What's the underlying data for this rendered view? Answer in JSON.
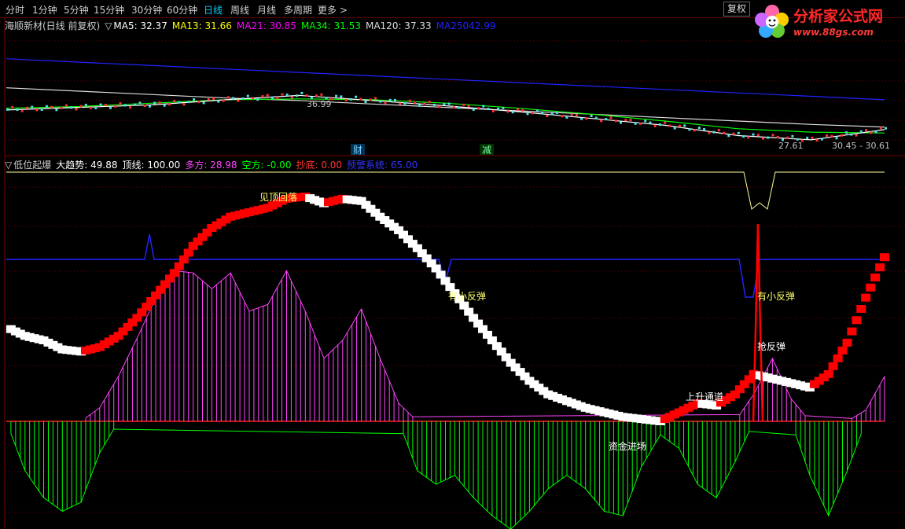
{
  "toolbar": {
    "tabs": [
      "分时",
      "1分钟",
      "5分钟",
      "15分钟",
      "30分钟",
      "60分钟",
      "日线",
      "周线",
      "月线",
      "多周期",
      "更多 >"
    ],
    "active": "日线",
    "fq_button": "复权"
  },
  "logo": {
    "title": "分析家公式网",
    "url": "www.88gs.com"
  },
  "price_panel": {
    "stock": "海顺新材(日线 前复权)",
    "toggle": "▽",
    "ma": [
      {
        "label": "MA5: ",
        "value": "32.37",
        "color": "#ffffff"
      },
      {
        "label": "MA13: ",
        "value": "31.66",
        "color": "#ffff00"
      },
      {
        "label": "MA21: ",
        "value": "30.85",
        "color": "#ff00ff"
      },
      {
        "label": "MA34: ",
        "value": "31.53",
        "color": "#00ff00"
      },
      {
        "label": "MA120: ",
        "value": "37.33",
        "color": "#dddddd"
      },
      {
        "label": "MA250",
        "value": "42.99",
        "color": "#2222ff"
      }
    ],
    "markers": {
      "cai": "财",
      "jian": "减"
    },
    "annotations": {
      "high": "36.99",
      "low": "27.61",
      "right": "30.45 - 30.61"
    }
  },
  "indicator_panel": {
    "name": "低位起爆",
    "toggle": "▽",
    "fields": [
      {
        "label": "大趋势: ",
        "value": "49.88",
        "color": "#ffffff"
      },
      {
        "label": "顶线: ",
        "value": "100.00",
        "color": "#ffffff"
      },
      {
        "label": "多方: ",
        "value": "28.98",
        "color": "#ff44ff"
      },
      {
        "label": "空方: ",
        "value": "-0.00",
        "color": "#00ff00"
      },
      {
        "label": "抄底: ",
        "value": "0.00",
        "color": "#ff3333"
      },
      {
        "label": "预警系统: ",
        "value": "65.00",
        "color": "#3333ff"
      }
    ],
    "annotations": {
      "top_fall": "见顶回落",
      "small_rebound_1": "有小反弹",
      "small_rebound_2": "有小反弹",
      "grab_rebound": "抢反弹",
      "rising_channel": "上升通道",
      "capital_entry": "资金进场"
    }
  },
  "colors": {
    "bull": "#ff0000",
    "bear": "#ffffff",
    "multi": "#ff44ff",
    "empty": "#00ff00",
    "warn": "#2222ff",
    "top": "#ffff99",
    "grid": "#7a0000"
  },
  "chart_data": [
    {
      "type": "line",
      "title": "",
      "series": [
        {
          "name": "MA250",
          "values": [
            37.8,
            37.4,
            37.0,
            36.6,
            36.2,
            35.8,
            35.4,
            35.0,
            34.6,
            34.2,
            33.8,
            33.4,
            33.0
          ]
        },
        {
          "name": "MA120",
          "values": [
            34.4,
            34.0,
            33.6,
            33.2,
            32.9,
            32.5,
            32.1,
            31.7,
            31.3,
            30.9,
            30.5,
            30.1,
            29.8
          ]
        },
        {
          "name": "MA34",
          "values": [
            32.0,
            32.2,
            32.6,
            33.0,
            33.1,
            33.0,
            32.6,
            32.0,
            31.3,
            30.5,
            29.6,
            29.2,
            29.1
          ]
        },
        {
          "name": "MA5",
          "values": [
            31.8,
            32.1,
            32.4,
            33.0,
            33.5,
            32.9,
            32.3,
            31.6,
            30.8,
            30.0,
            28.8,
            28.3,
            29.5
          ]
        }
      ]
    },
    {
      "type": "bar",
      "title": "低位起爆",
      "series": [
        {
          "name": "大趋势",
          "values": [
            42,
            38,
            36,
            32,
            31,
            33,
            38,
            46,
            56,
            66,
            78,
            86,
            91,
            93,
            95,
            99,
            100,
            97,
            99,
            98,
            91,
            85,
            77,
            68,
            57,
            46,
            36,
            26,
            18,
            12,
            9,
            6,
            4,
            2,
            1,
            0,
            4,
            8,
            7,
            12,
            21,
            19,
            17,
            15,
            21,
            35,
            55,
            73
          ]
        },
        {
          "name": "多方",
          "values": [
            0,
            0,
            0,
            0,
            0,
            6,
            20,
            37,
            55,
            67,
            66,
            59,
            66,
            49,
            52,
            67,
            49,
            28,
            36,
            50,
            28,
            8,
            0,
            0,
            0,
            0,
            0,
            0,
            0,
            0,
            0,
            0,
            0,
            0,
            0,
            0,
            0,
            0,
            0,
            0,
            12,
            28,
            10,
            0,
            0,
            0,
            5,
            20
          ]
        },
        {
          "name": "空方",
          "values": [
            0,
            -22,
            -34,
            -40,
            -36,
            -14,
            0,
            0,
            0,
            0,
            0,
            0,
            0,
            0,
            0,
            0,
            0,
            0,
            0,
            0,
            0,
            0,
            -22,
            -28,
            -24,
            -34,
            -42,
            -48,
            -40,
            -30,
            -24,
            -30,
            -40,
            -42,
            -20,
            -6,
            -12,
            -28,
            -34,
            -18,
            0,
            0,
            0,
            -24,
            -42,
            -22,
            0,
            0
          ]
        }
      ]
    }
  ]
}
